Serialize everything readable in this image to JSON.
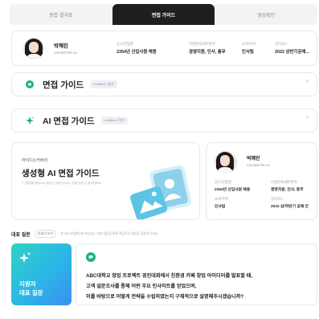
{
  "tabs": [
    {
      "label": "종합 결과표"
    },
    {
      "label": "면접 가이드"
    },
    {
      "label": "영상확인"
    }
  ],
  "profile": {
    "name": "박혜린",
    "id": "123456789-12",
    "fields": [
      {
        "label": "공고/전형명",
        "value": "2354년 신입사원 채용"
      },
      {
        "label": "지원분야/세부분야",
        "value": "경영지원, 인사, 총무"
      },
      {
        "label": "소속/부서",
        "value": "인사팀"
      },
      {
        "label": "관리코드",
        "value": "2022 상반기공채..."
      }
    ]
  },
  "sections": [
    {
      "title": "면접 가이드",
      "badge": "modified 7점수"
    },
    {
      "title": "AI 면접 가이드",
      "badge": "modified 7점수"
    }
  ],
  "promo": {
    "brand": "하이디스커버리",
    "title": "생성형 AI 면접 가이드",
    "description": "ⓘ 응답을 바탕으로 생성된 가이드입니다. 면접 진행 시 참고하세요."
  },
  "side_profile": {
    "name": "박혜린",
    "id": "123456789-12",
    "fields": [
      {
        "label": "공고/전형명",
        "value": "2354년 신입사원 채용"
      },
      {
        "label": "지원분야/세부분야",
        "value": "경영지원, 인사, 총무"
      },
      {
        "label": "소속/부서",
        "value": "인사팀"
      },
      {
        "label": "관리코드",
        "value": "2022 상/하반기 공채 진"
      }
    ]
  },
  "question_bar": {
    "title": "대표 질문",
    "toggle": "자세히 보기",
    "hint": "용시자 모범패턴에 제공되는 대표 질문을 통해 핵심적인 경험을 검증해 보세요."
  },
  "question_tile": {
    "line1": "지원자",
    "line2": "대표 질문"
  },
  "question": {
    "lines": [
      "ABC대학교 창업 프로젝트 경진대회에서 친환경 카페 창업 아이디어를 발표할 때,",
      "고객 설문조사를 통해 어떤 주요 인사이트를 얻었으며,",
      "이를 바탕으로 어떻게 전략을 수립하였는지 구체적으로 설명해주시겠습니까?"
    ]
  },
  "colors": {
    "accent_green": "#18b47b",
    "tab_active": "#1f1f1f",
    "tile_gradient_start": "#2fd2c4",
    "tile_gradient_end": "#3a8ef0"
  }
}
